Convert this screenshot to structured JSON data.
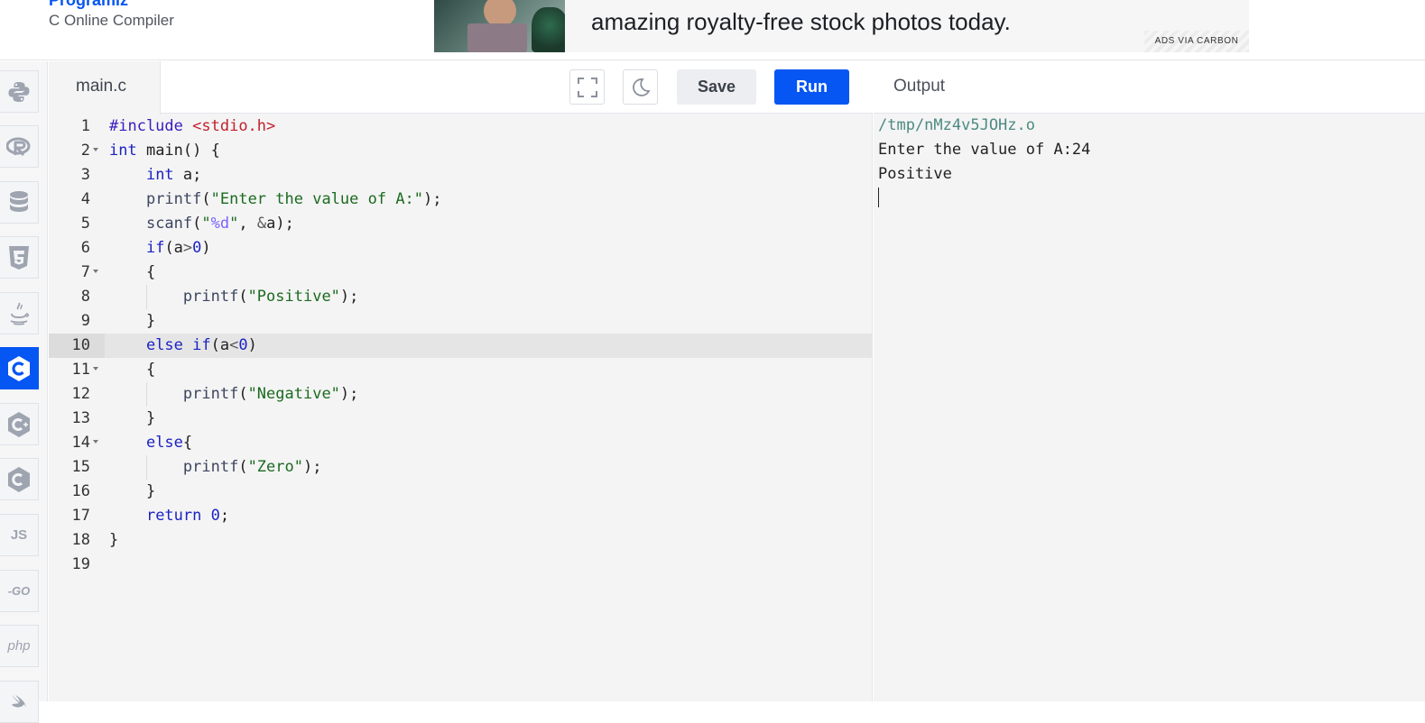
{
  "header": {
    "brand": "Programiz",
    "subtitle": "C Online Compiler"
  },
  "ad": {
    "text": "amazing royalty-free stock photos today.",
    "badge": "ADS VIA CARBON"
  },
  "rail": {
    "items": [
      {
        "name": "python",
        "label": ""
      },
      {
        "name": "r",
        "label": ""
      },
      {
        "name": "sql",
        "label": ""
      },
      {
        "name": "html",
        "label": ""
      },
      {
        "name": "java",
        "label": ""
      },
      {
        "name": "c",
        "label": "",
        "active": true
      },
      {
        "name": "cpp",
        "label": ""
      },
      {
        "name": "csharp",
        "label": ""
      },
      {
        "name": "js",
        "label": "JS"
      },
      {
        "name": "go",
        "label": "-GO"
      },
      {
        "name": "php",
        "label": "php"
      }
    ]
  },
  "editor": {
    "file_tab": "main.c",
    "save_label": "Save",
    "run_label": "Run",
    "active_line": 10,
    "lines": [
      {
        "n": "1",
        "text": "#include <stdio.h>"
      },
      {
        "n": "2",
        "text": "int main() {"
      },
      {
        "n": "3",
        "text": "    int a;"
      },
      {
        "n": "4",
        "text": "    printf(\"Enter the value of A:\");"
      },
      {
        "n": "5",
        "text": "    scanf(\"%d\", &a);"
      },
      {
        "n": "6",
        "text": "    if(a>0)"
      },
      {
        "n": "7",
        "text": "    {"
      },
      {
        "n": "8",
        "text": "        printf(\"Positive\");"
      },
      {
        "n": "9",
        "text": "    }"
      },
      {
        "n": "10",
        "text": "    else if(a<0)"
      },
      {
        "n": "11",
        "text": "    {"
      },
      {
        "n": "12",
        "text": "        printf(\"Negative\");"
      },
      {
        "n": "13",
        "text": "    }"
      },
      {
        "n": "14",
        "text": "    else{"
      },
      {
        "n": "15",
        "text": "        printf(\"Zero\");"
      },
      {
        "n": "16",
        "text": "    }"
      },
      {
        "n": "17",
        "text": "    return 0;"
      },
      {
        "n": "18",
        "text": "}"
      },
      {
        "n": "19",
        "text": ""
      }
    ]
  },
  "output": {
    "title": "Output",
    "path": "/tmp/nMz4v5JOHz.o",
    "lines": [
      "Enter the value of A:24",
      "Positive"
    ]
  },
  "colors": {
    "accent": "#0556f3",
    "editor_bg": "#f4f4f4"
  }
}
